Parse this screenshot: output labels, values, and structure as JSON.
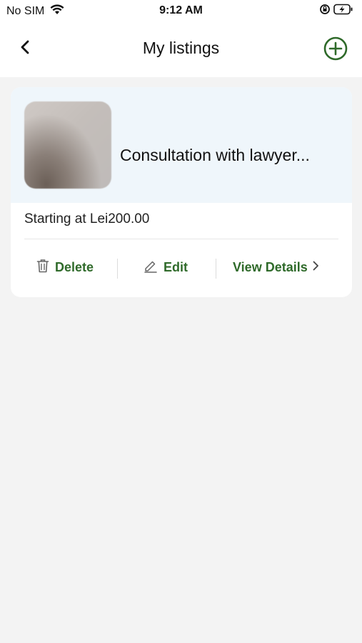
{
  "status_bar": {
    "carrier": "No SIM",
    "time": "9:12 AM"
  },
  "header": {
    "title": "My listings",
    "back_icon": "chevron-left-icon",
    "add_icon": "plus-circle-icon"
  },
  "listing": {
    "title": "Consultation with lawyer...",
    "price": "Starting at Lei200.00",
    "actions": {
      "delete": "Delete",
      "edit": "Edit",
      "view_details": "View Details"
    }
  },
  "colors": {
    "accent": "#2f6a2a",
    "card_top": "#eff6fb",
    "background": "#f3f3f3"
  }
}
